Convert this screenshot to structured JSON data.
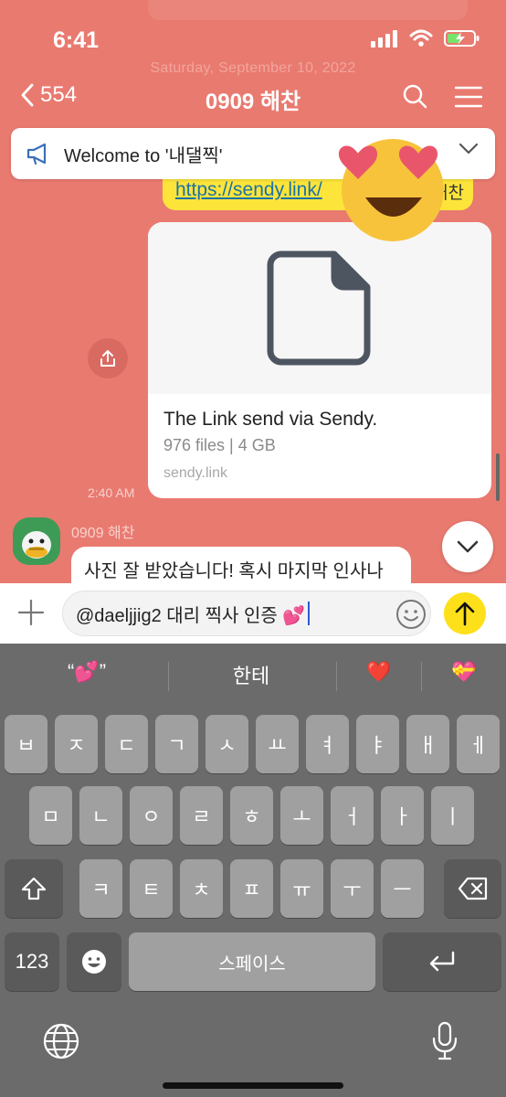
{
  "status": {
    "time": "6:41"
  },
  "background": {
    "date_text": "Saturday, September 10, 2022"
  },
  "header": {
    "unread_count": "554",
    "title": "0909 해찬"
  },
  "notice": {
    "text": "Welcome to '내댈찍'"
  },
  "link_message": {
    "link": "https://sendy.link/",
    "tail": "해찬"
  },
  "link_card": {
    "title": "The Link send via Sendy.",
    "subtitle": "976 files | 4 GB",
    "domain": "sendy.link"
  },
  "message_time": "2:40 AM",
  "received": {
    "sender": "0909 해찬",
    "text": "사진 잘 받았습니다! 혹시 마지막 인사나"
  },
  "input": {
    "value": "@daeljjig2 대리 찍사 인증 💕"
  },
  "keyboard": {
    "suggestions": [
      "“💕”",
      "한테",
      "❤️",
      "💝"
    ],
    "row1": [
      "ㅂ",
      "ㅈ",
      "ㄷ",
      "ㄱ",
      "ㅅ",
      "ㅛ",
      "ㅕ",
      "ㅑ",
      "ㅐ",
      "ㅔ"
    ],
    "row2": [
      "ㅁ",
      "ㄴ",
      "ㅇ",
      "ㄹ",
      "ㅎ",
      "ㅗ",
      "ㅓ",
      "ㅏ",
      "ㅣ"
    ],
    "row3": [
      "ㅋ",
      "ㅌ",
      "ㅊ",
      "ㅍ",
      "ㅠ",
      "ㅜ",
      "ㅡ"
    ],
    "numbers_label": "123",
    "space_label": "스페이스"
  },
  "colors": {
    "chat_bg": "#e97a70",
    "bubble_yellow": "#fde43a",
    "keyboard_bg": "#6b6b6b",
    "key": "#a0a0a0",
    "send": "#fde01a"
  }
}
